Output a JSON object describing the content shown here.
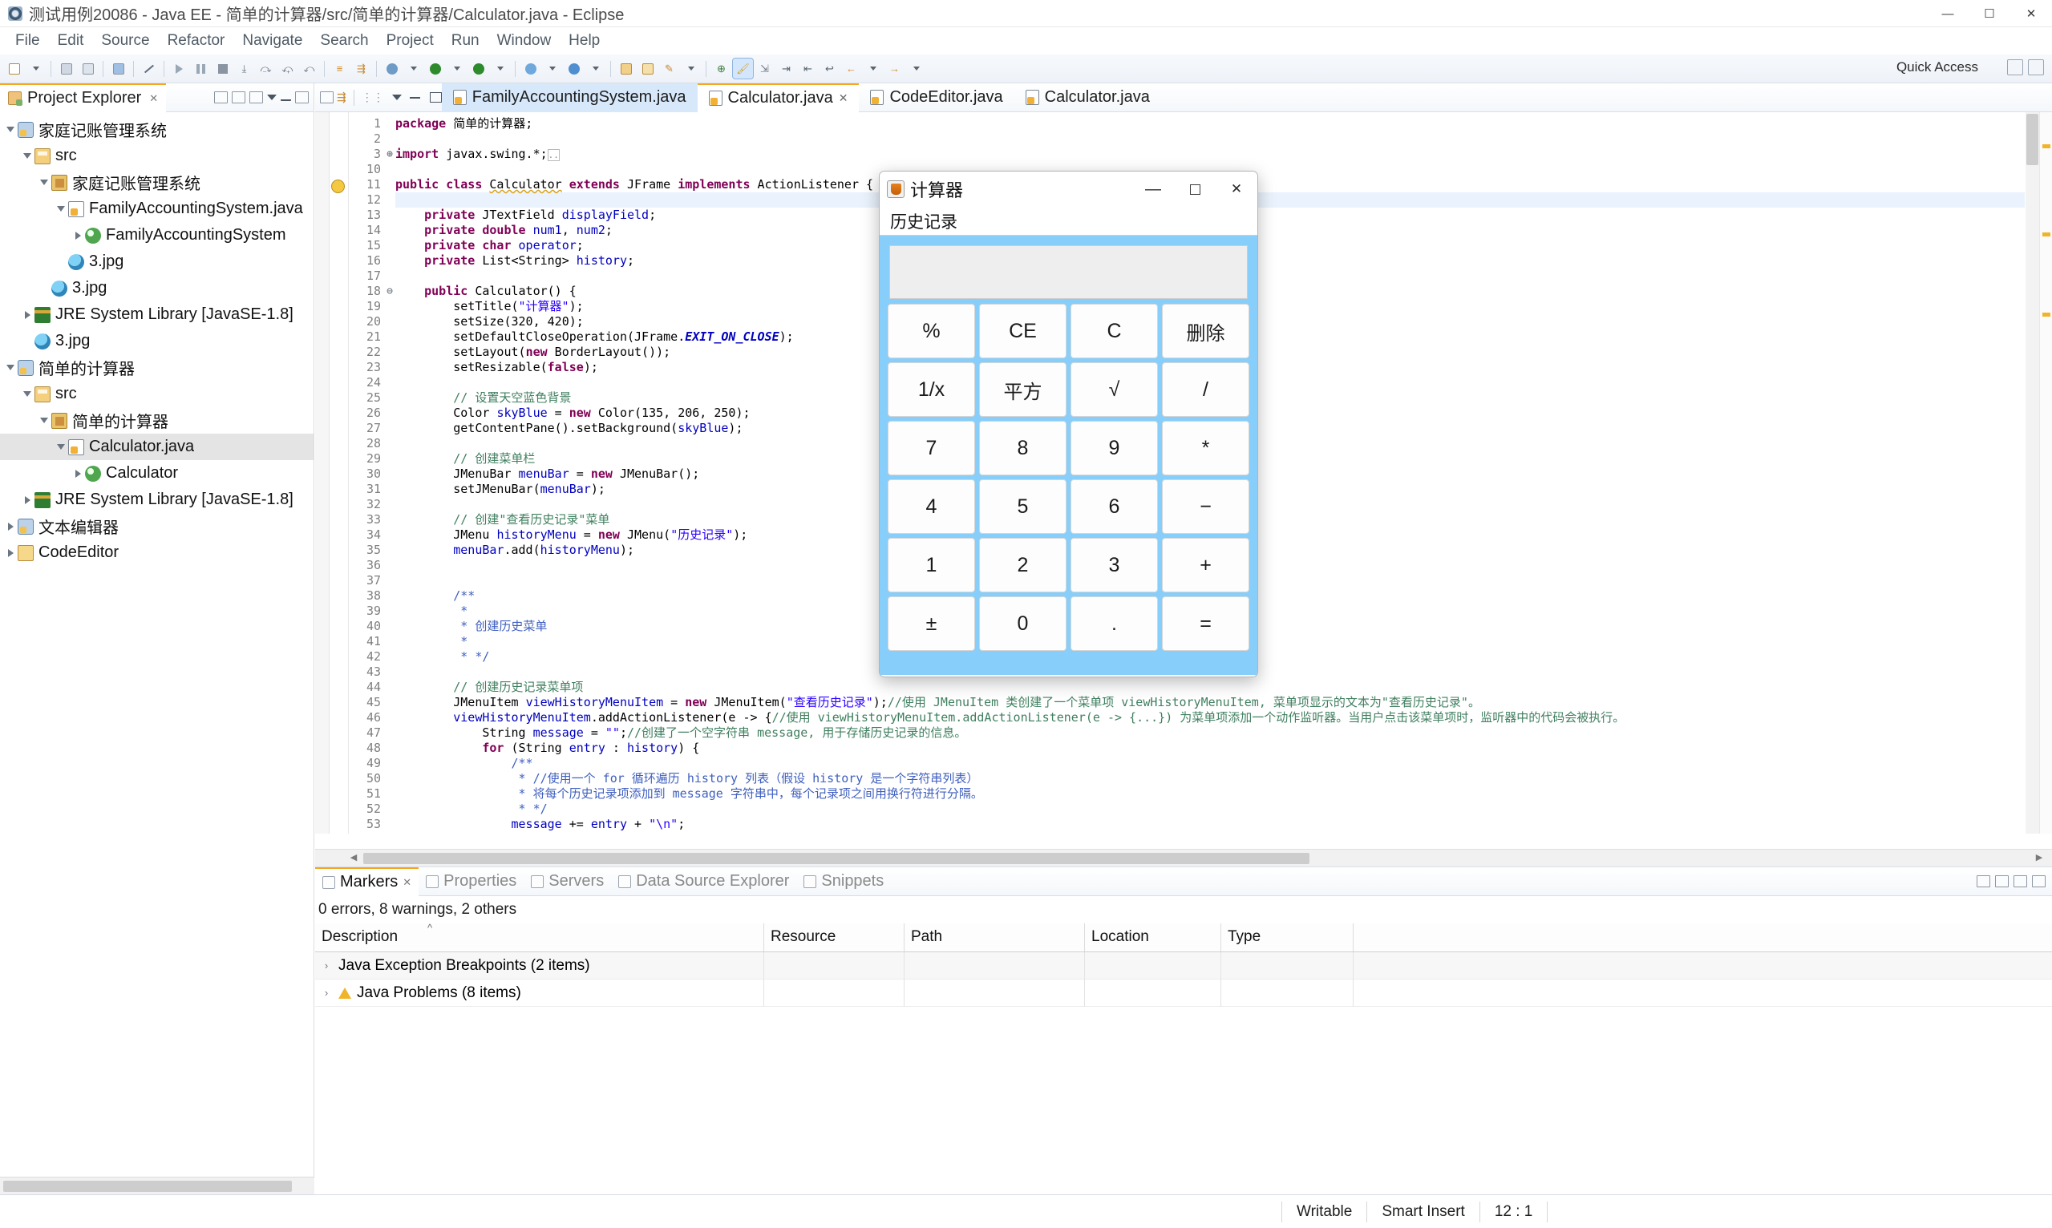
{
  "window": {
    "title": "测试用例20086 - Java EE - 简单的计算器/src/简单的计算器/Calculator.java - Eclipse",
    "icon": "eclipse-icon",
    "controls": {
      "minimize": "—",
      "maximize": "☐",
      "close": "✕"
    }
  },
  "menubar": {
    "items": [
      "File",
      "Edit",
      "Source",
      "Refactor",
      "Navigate",
      "Search",
      "Project",
      "Run",
      "Window",
      "Help"
    ]
  },
  "toolbar": {
    "quick_access": "Quick Access"
  },
  "project_explorer": {
    "tab_label": "Project Explorer",
    "close_glyph": "✕",
    "tree": [
      {
        "label": "家庭记账管理系统",
        "indent": 0,
        "arrow": "open",
        "icon": "project-icon"
      },
      {
        "label": "src",
        "indent": 1,
        "arrow": "open",
        "icon": "source-folder-icon"
      },
      {
        "label": "家庭记账管理系统",
        "indent": 2,
        "arrow": "open",
        "icon": "package-icon"
      },
      {
        "label": "FamilyAccountingSystem.java",
        "indent": 3,
        "arrow": "open",
        "icon": "java-file-icon"
      },
      {
        "label": "FamilyAccountingSystem",
        "indent": 4,
        "arrow": "closed",
        "icon": "class-icon"
      },
      {
        "label": "3.jpg",
        "indent": 3,
        "arrow": "none",
        "icon": "image-file-icon"
      },
      {
        "label": "3.jpg",
        "indent": 2,
        "arrow": "none",
        "icon": "image-file-icon"
      },
      {
        "label": "JRE System Library [JavaSE-1.8]",
        "indent": 1,
        "arrow": "closed",
        "icon": "library-icon"
      },
      {
        "label": "3.jpg",
        "indent": 1,
        "arrow": "none",
        "icon": "image-file-icon"
      },
      {
        "label": "简单的计算器",
        "indent": 0,
        "arrow": "open",
        "icon": "project-icon"
      },
      {
        "label": "src",
        "indent": 1,
        "arrow": "open",
        "icon": "source-folder-icon"
      },
      {
        "label": "简单的计算器",
        "indent": 2,
        "arrow": "open",
        "icon": "package-icon"
      },
      {
        "label": "Calculator.java",
        "indent": 3,
        "arrow": "open",
        "icon": "java-file-icon",
        "selected": true
      },
      {
        "label": "Calculator",
        "indent": 4,
        "arrow": "closed",
        "icon": "class-icon"
      },
      {
        "label": "JRE System Library [JavaSE-1.8]",
        "indent": 1,
        "arrow": "closed",
        "icon": "library-icon"
      },
      {
        "label": "文本编辑器",
        "indent": 0,
        "arrow": "closed",
        "icon": "project-icon"
      },
      {
        "label": "CodeEditor",
        "indent": 0,
        "arrow": "closed",
        "icon": "folder-icon"
      }
    ]
  },
  "editor": {
    "tabs": [
      {
        "label": "FamilyAccountingSystem.java",
        "state": "active-inactive",
        "closable": false
      },
      {
        "label": "Calculator.java",
        "state": "active",
        "closable": true,
        "close_glyph": "✕"
      },
      {
        "label": "CodeEditor.java",
        "state": "normal",
        "closable": false
      },
      {
        "label": "Calculator.java",
        "state": "normal",
        "closable": false
      }
    ],
    "lines": [
      {
        "n": "1",
        "fold": "",
        "html": "<span class=\"kw\">package</span> 简单的计算器;"
      },
      {
        "n": "2",
        "fold": "",
        "html": ""
      },
      {
        "n": "3",
        "fold": "⊕",
        "html": "<span class=\"kw\">import</span> javax.swing.*;<span style=\"border:1px solid #b9b9b9;color:#8a8a8a;font-size:11px;\">..</span>"
      },
      {
        "n": "10",
        "fold": "",
        "html": ""
      },
      {
        "n": "11",
        "fold": "",
        "html": "<span class=\"kw\">public</span> <span class=\"kw\">class</span> <span class=\"err\">Calculator</span> <span class=\"kw\">extends</span> JFrame <span class=\"kw\">implements</span> ActionListener {",
        "warn": true
      },
      {
        "n": "12",
        "fold": "",
        "html": "",
        "hl": true
      },
      {
        "n": "13",
        "fold": "",
        "html": "    <span class=\"kw\">private</span> JTextField <span class=\"fld\">displayField</span>;"
      },
      {
        "n": "14",
        "fold": "",
        "html": "    <span class=\"kw\">private</span> <span class=\"kw\">double</span> <span class=\"fld\">num1</span>, <span class=\"fld\">num2</span>;"
      },
      {
        "n": "15",
        "fold": "",
        "html": "    <span class=\"kw\">private</span> <span class=\"kw\">char</span> <span class=\"fld\">operator</span>;"
      },
      {
        "n": "16",
        "fold": "",
        "html": "    <span class=\"kw\">private</span> List&lt;String&gt; <span class=\"fld\">history</span>;"
      },
      {
        "n": "17",
        "fold": "",
        "html": ""
      },
      {
        "n": "18",
        "fold": "⊖",
        "html": "    <span class=\"kw\">public</span> Calculator() {"
      },
      {
        "n": "19",
        "fold": "",
        "html": "        setTitle(<span class=\"st\">\"计算器\"</span>);"
      },
      {
        "n": "20",
        "fold": "",
        "html": "        setSize(320, 420);"
      },
      {
        "n": "21",
        "fold": "",
        "html": "        setDefaultCloseOperation(JFrame.<span class=\"sf\">EXIT_ON_CLOSE</span>);"
      },
      {
        "n": "22",
        "fold": "",
        "html": "        setLayout(<span class=\"kw\">new</span> BorderLayout());"
      },
      {
        "n": "23",
        "fold": "",
        "html": "        setResizable(<span class=\"kw\">false</span>);"
      },
      {
        "n": "24",
        "fold": "",
        "html": ""
      },
      {
        "n": "25",
        "fold": "",
        "html": "        <span class=\"cm\">// 设置天空蓝色背景</span>"
      },
      {
        "n": "26",
        "fold": "",
        "html": "        Color <span class=\"fld\">skyBlue</span> = <span class=\"kw\">new</span> Color(135, 206, 250);"
      },
      {
        "n": "27",
        "fold": "",
        "html": "        getContentPane().setBackground(<span class=\"fld\">skyBlue</span>);"
      },
      {
        "n": "28",
        "fold": "",
        "html": ""
      },
      {
        "n": "29",
        "fold": "",
        "html": "        <span class=\"cm\">// 创建菜单栏</span>"
      },
      {
        "n": "30",
        "fold": "",
        "html": "        JMenuBar <span class=\"fld\">menuBar</span> = <span class=\"kw\">new</span> JMenuBar();"
      },
      {
        "n": "31",
        "fold": "",
        "html": "        setJMenuBar(<span class=\"fld\">menuBar</span>);"
      },
      {
        "n": "32",
        "fold": "",
        "html": ""
      },
      {
        "n": "33",
        "fold": "",
        "html": "        <span class=\"cm\">// 创建\"查看历史记录\"菜单</span>"
      },
      {
        "n": "34",
        "fold": "",
        "html": "        JMenu <span class=\"fld\">historyMenu</span> = <span class=\"kw\">new</span> JMenu(<span class=\"st\">\"历史记录\"</span>);"
      },
      {
        "n": "35",
        "fold": "",
        "html": "        <span class=\"fld\">menuBar</span>.add(<span class=\"fld\">historyMenu</span>);"
      },
      {
        "n": "36",
        "fold": "",
        "html": ""
      },
      {
        "n": "37",
        "fold": "",
        "html": ""
      },
      {
        "n": "38",
        "fold": "",
        "html": "        <span class=\"jd\">/**</span>"
      },
      {
        "n": "39",
        "fold": "",
        "html": "         <span class=\"jd\">*</span>"
      },
      {
        "n": "40",
        "fold": "",
        "html": "         <span class=\"jd\">* 创建历史菜单</span>"
      },
      {
        "n": "41",
        "fold": "",
        "html": "         <span class=\"jd\">*</span>"
      },
      {
        "n": "42",
        "fold": "",
        "html": "         <span class=\"jd\">* */</span>"
      },
      {
        "n": "43",
        "fold": "",
        "html": ""
      },
      {
        "n": "44",
        "fold": "",
        "html": "        <span class=\"cm\">// 创建历史记录菜单项</span>"
      },
      {
        "n": "45",
        "fold": "",
        "html": "        JMenuItem <span class=\"fld\">viewHistoryMenuItem</span> = <span class=\"kw\">new</span> JMenuItem(<span class=\"st\">\"查看历史记录\"</span>);<span class=\"cm\">//使用 JMenuItem 类创建了一个菜单项 viewHistoryMenuItem, 菜单项显示的文本为\"查看历史记录\"。</span>"
      },
      {
        "n": "46",
        "fold": "",
        "html": "        <span class=\"fld\">viewHistoryMenuItem</span>.addActionListener(e -&gt; {<span class=\"cm\">//使用 viewHistoryMenuItem.addActionListener(e -&gt; {...}) 为菜单项添加一个动作监听器。当用户点击该菜单项时，监听器中的代码会被执行。</span>"
      },
      {
        "n": "47",
        "fold": "",
        "html": "            String <span class=\"fld\">message</span> = <span class=\"st\">\"\"</span>;<span class=\"cm\">//创建了一个空字符串 message, 用于存储历史记录的信息。</span>"
      },
      {
        "n": "48",
        "fold": "",
        "html": "            <span class=\"kw\">for</span> (String <span class=\"fld\">entry</span> : <span class=\"fld\">history</span>) {"
      },
      {
        "n": "49",
        "fold": "",
        "html": "                <span class=\"jd\">/**</span>"
      },
      {
        "n": "50",
        "fold": "",
        "html": "                 <span class=\"jd\">* //使用一个 for 循环遍历 history 列表（假设 history 是一个字符串列表）</span>"
      },
      {
        "n": "51",
        "fold": "",
        "html": "                 <span class=\"jd\">* 将每个历史记录项添加到 message 字符串中，每个记录项之间用换行符进行分隔。</span>"
      },
      {
        "n": "52",
        "fold": "",
        "html": "                 <span class=\"jd\">* */</span>"
      },
      {
        "n": "53",
        "fold": "",
        "html": "                <span class=\"fld\">message</span> += <span class=\"fld\">entry</span> + <span class=\"st\">\"\\n\"</span>;"
      }
    ]
  },
  "markers": {
    "tabs": [
      {
        "label": "Markers",
        "active": true,
        "close_glyph": "✕"
      },
      {
        "label": "Properties",
        "active": false
      },
      {
        "label": "Servers",
        "active": false
      },
      {
        "label": "Data Source Explorer",
        "active": false
      },
      {
        "label": "Snippets",
        "active": false
      }
    ],
    "summary": "0 errors, 8 warnings, 2 others",
    "columns": [
      "Description",
      "Resource",
      "Path",
      "Location",
      "Type"
    ],
    "sort_indicator": "^",
    "rows": [
      {
        "description": "Java Exception Breakpoints (2 items)",
        "icon": "none",
        "resource": "",
        "path": "",
        "location": "",
        "type": ""
      },
      {
        "description": "Java Problems (8 items)",
        "icon": "warning",
        "resource": "",
        "path": "",
        "location": "",
        "type": ""
      }
    ]
  },
  "statusbar": {
    "writable": "Writable",
    "insert_mode": "Smart Insert",
    "position": "12 : 1"
  },
  "calculator": {
    "title": "计算器",
    "icon": "java-coffee-icon",
    "controls": {
      "minimize": "—",
      "maximize": "❐",
      "close": "✕"
    },
    "menu": [
      "历史记录"
    ],
    "display_value": "",
    "accent_color": "#87ceFA",
    "keys": [
      "%",
      "CE",
      "C",
      "删除",
      "1/x",
      "平方",
      "√",
      "/",
      "7",
      "8",
      "9",
      "*",
      "4",
      "5",
      "6",
      "−",
      "1",
      "2",
      "3",
      "+",
      "±",
      "0",
      ".",
      "="
    ]
  }
}
